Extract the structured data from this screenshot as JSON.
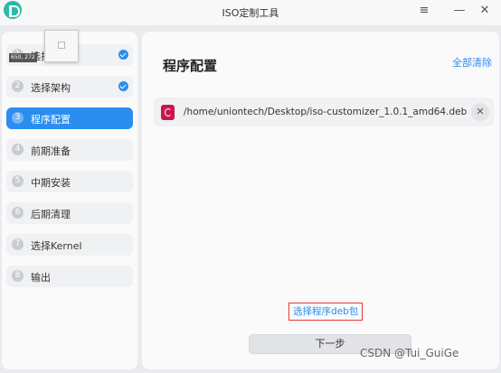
{
  "window": {
    "title": "ISO定制工具",
    "menu_glyph": "≡",
    "minimize_glyph": "—",
    "close_glyph": "✕",
    "logo_icon": "deepin-d-logo"
  },
  "sidebar": {
    "items": [
      {
        "num": "1",
        "label": "选择",
        "done": true
      },
      {
        "num": "2",
        "label": "选择架构",
        "done": true
      },
      {
        "num": "3",
        "label": "程序配置",
        "active": true
      },
      {
        "num": "4",
        "label": "前期准备"
      },
      {
        "num": "5",
        "label": "中期安装"
      },
      {
        "num": "6",
        "label": "后期清理"
      },
      {
        "num": "7",
        "label": "选择Kernel"
      },
      {
        "num": "8",
        "label": "输出"
      }
    ],
    "accent_color": "#2b8df0"
  },
  "tooltip": {
    "coords": "650, 272"
  },
  "main": {
    "title": "程序配置",
    "clear_all": "全部清除",
    "files": [
      {
        "path": "/home/uniontech/Desktop/iso-customizer_1.0.1_amd64.deb",
        "icon": "debian-package-icon"
      }
    ],
    "remove_glyph": "✕",
    "choose_deb": "选择程序deb包",
    "next": "下一步"
  },
  "watermark": "CSDN @Tui_GuiGe"
}
